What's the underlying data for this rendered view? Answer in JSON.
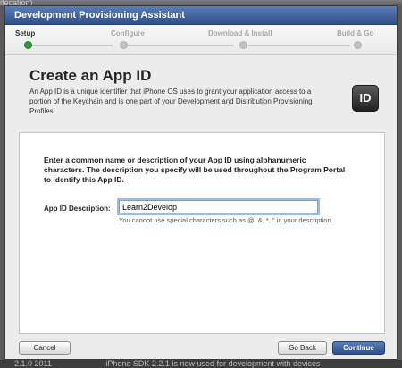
{
  "window": {
    "title": "Development Provisioning Assistant"
  },
  "steps": [
    {
      "label": "Setup",
      "active": true
    },
    {
      "label": "Configure",
      "active": false
    },
    {
      "label": "Download & Install",
      "active": false
    },
    {
      "label": "Build & Go",
      "active": false
    }
  ],
  "page": {
    "heading": "Create an App ID",
    "intro": "An App ID is a unique identifier that iPhone OS uses to grant your application access to a portion of the Keychain and is one part of your Development and Distribution Provisioning Profiles.",
    "badge": "ID"
  },
  "form": {
    "instructions": "Enter a common name or description of your App ID using alphanumeric characters. The description you specify will be used throughout the Program Portal to identify this App ID.",
    "label": "App ID Description:",
    "value": "Learn2Develop",
    "hint": "You cannot use special characters such as @, &, *, \" in your description."
  },
  "buttons": {
    "cancel": "Cancel",
    "back": "Go Back",
    "continue": "Continue"
  },
  "colors": {
    "title_bar": "#3d5f99",
    "active_step": "#2f9a3e",
    "primary_button": "#3a5e97"
  },
  "backdrop": {
    "top_text": "ifecation)",
    "bottom_left": "2.1.0 2011",
    "bottom_right": "iPhone SDK 2.2.1 is now used for development with devices"
  }
}
